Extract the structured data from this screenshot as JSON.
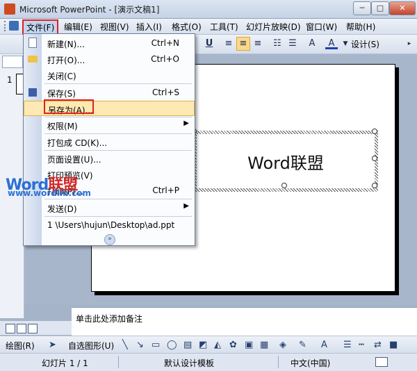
{
  "window": {
    "title": "Microsoft PowerPoint - [演示文稿1]",
    "min_label": "─",
    "max_label": "□",
    "close_label": "✕"
  },
  "menubar": {
    "items": [
      "文件(F)",
      "编辑(E)",
      "视图(V)",
      "插入(I)",
      "格式(O)",
      "工具(T)",
      "幻灯片放映(D)",
      "窗口(W)",
      "帮助(H)"
    ]
  },
  "toolbar": {
    "design_label": "设计(S)"
  },
  "file_menu": {
    "items": [
      {
        "label": "新建(N)...",
        "shortcut": "Ctrl+N"
      },
      {
        "label": "打开(O)...",
        "shortcut": "Ctrl+O"
      },
      {
        "label": "关闭(C)",
        "shortcut": ""
      },
      {
        "label": "保存(S)",
        "shortcut": "Ctrl+S"
      },
      {
        "label": "另存为(A)...",
        "shortcut": ""
      },
      {
        "label": "权限(M)",
        "shortcut": ""
      },
      {
        "label": "打包成 CD(K)...",
        "shortcut": ""
      },
      {
        "label": "页面设置(U)...",
        "shortcut": ""
      },
      {
        "label": "打印预览(V)",
        "shortcut": ""
      },
      {
        "label": "打印(P)...",
        "shortcut": "Ctrl+P"
      },
      {
        "label": "发送(D)",
        "shortcut": ""
      },
      {
        "label": "1 \\Users\\hujun\\Desktop\\ad.ppt",
        "shortcut": ""
      }
    ],
    "expand_label": "»"
  },
  "slide": {
    "number": "1",
    "title_text": "Word联盟"
  },
  "notes": {
    "placeholder": "单击此处添加备注"
  },
  "drawbar": {
    "draw_label": "绘图(R)",
    "autoshapes_label": "自选图形(U)"
  },
  "statusbar": {
    "slide_info": "幻灯片 1 / 1",
    "template": "默认设计模板",
    "language": "中文(中国)"
  },
  "watermark": {
    "logo_a": "Word",
    "logo_b": "联盟",
    "url": "www.wordlm.com"
  }
}
